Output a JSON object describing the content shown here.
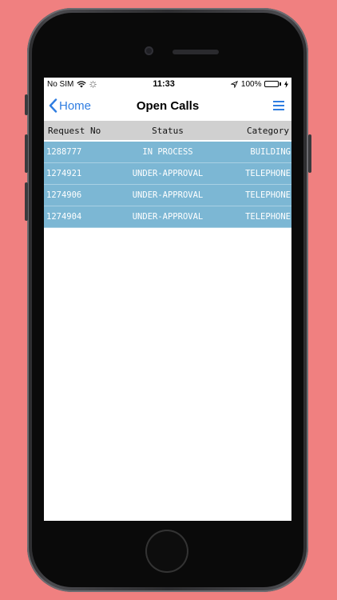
{
  "statusbar": {
    "carrier": "No SIM",
    "time": "11:33",
    "battery": "100%",
    "battery_level": 100
  },
  "navbar": {
    "back_label": "Home",
    "title": "Open Calls"
  },
  "table": {
    "columns": [
      "Request No",
      "Status",
      "Category"
    ],
    "rows": [
      {
        "request_no": "1288777",
        "status": "IN PROCESS",
        "category": "BUILDING"
      },
      {
        "request_no": "1274921",
        "status": "UNDER-APPROVAL",
        "category": "TELEPHONE"
      },
      {
        "request_no": "1274906",
        "status": "UNDER-APPROVAL",
        "category": "TELEPHONE"
      },
      {
        "request_no": "1274904",
        "status": "UNDER-APPROVAL",
        "category": "TELEPHONE"
      }
    ]
  },
  "colors": {
    "background": "#f08080",
    "accent": "#2f7de1",
    "row_background": "#7cb7d4",
    "header_background": "#d0d0d0",
    "battery": "#34c759"
  }
}
